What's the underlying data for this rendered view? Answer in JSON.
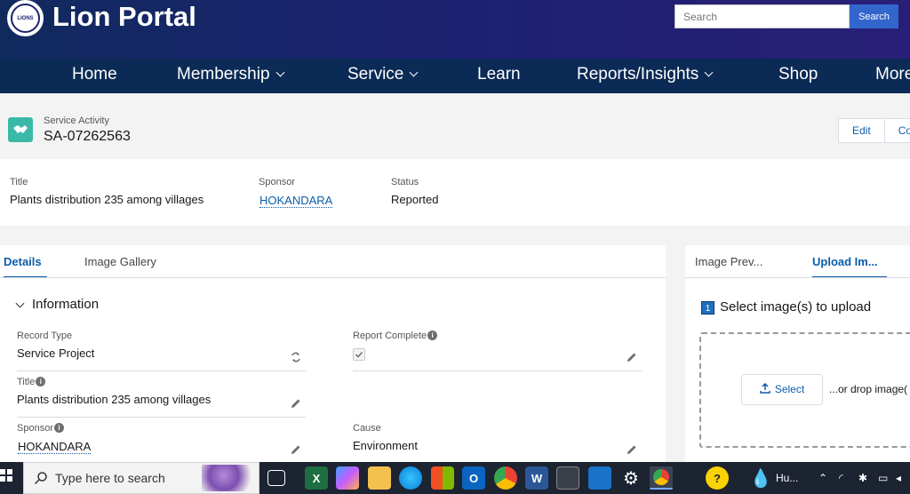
{
  "header": {
    "brand": "Lion Portal",
    "logo_text": "LIONS",
    "search_placeholder": "Search",
    "search_button": "Search"
  },
  "nav": {
    "items": [
      {
        "label": "Home",
        "has_dropdown": false
      },
      {
        "label": "Membership",
        "has_dropdown": true
      },
      {
        "label": "Service",
        "has_dropdown": true
      },
      {
        "label": "Learn",
        "has_dropdown": false
      },
      {
        "label": "Reports/Insights",
        "has_dropdown": true
      },
      {
        "label": "Shop",
        "has_dropdown": false
      },
      {
        "label": "More",
        "has_dropdown": false
      }
    ]
  },
  "record": {
    "object_type": "Service Activity",
    "name": "SA-07262563",
    "actions": [
      "Edit",
      "Co"
    ]
  },
  "highlights": {
    "title_label": "Title",
    "title_value": "Plants distribution 235 among villages",
    "sponsor_label": "Sponsor",
    "sponsor_value": "HOKANDARA",
    "status_label": "Status",
    "status_value": "Reported"
  },
  "main_tabs": [
    "Details",
    "Image Gallery"
  ],
  "information": {
    "section_title": "Information",
    "record_type_label": "Record Type",
    "record_type_value": "Service Project",
    "report_complete_label": "Report Complete",
    "report_complete_checked": true,
    "title_label": "Title",
    "title_value": "Plants distribution 235 among villages",
    "sponsor_label": "Sponsor",
    "sponsor_value": "HOKANDARA",
    "cause_label": "Cause",
    "cause_value": "Environment"
  },
  "side_tabs": [
    "Image Prev...",
    "Upload Im..."
  ],
  "upload": {
    "step_number": "1",
    "step_label": "Select image(s) to upload",
    "select_button": "Select",
    "drop_text": "...or drop image("
  },
  "taskbar": {
    "search_text": "Type here to search",
    "weather_text": "Hu...",
    "icons": [
      "task-view",
      "excel",
      "copilot",
      "file-explorer",
      "edge",
      "store",
      "outlook",
      "chrome",
      "word",
      "calculator",
      "calendar",
      "settings",
      "chrome-profile",
      "help",
      "weather"
    ]
  },
  "colors": {
    "header": "#1a2270",
    "nav": "#0b2a55",
    "accent": "#0b5cab",
    "record_icon": "#3bb9a8"
  }
}
